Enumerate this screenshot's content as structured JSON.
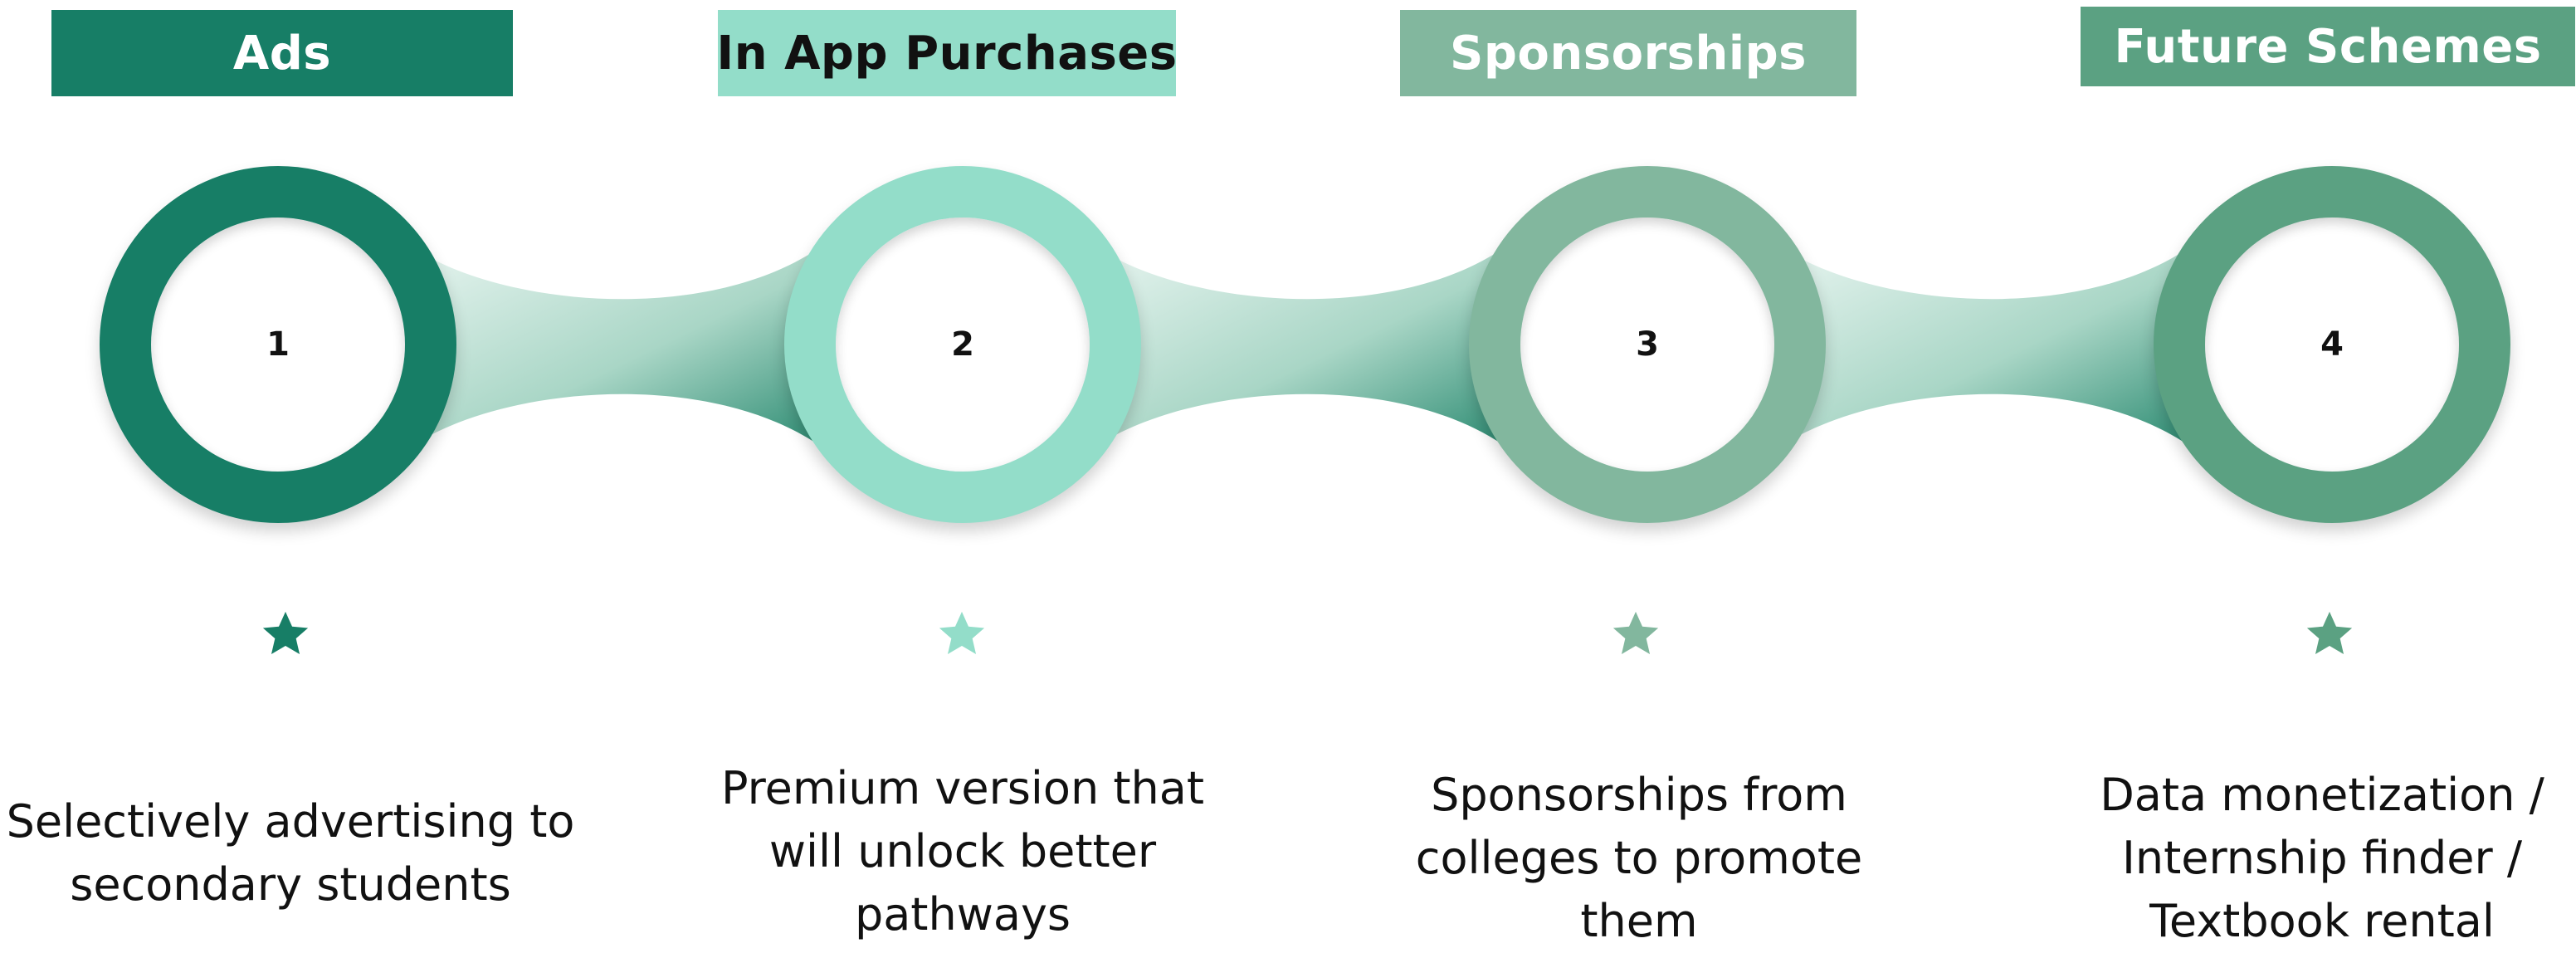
{
  "stages": [
    {
      "title": "Ads",
      "number": "1",
      "color": "#177e66",
      "title_color": "#ffffff",
      "star_icon": "star-icon",
      "description_lines": [
        "Selectively advertising to",
        "secondary students"
      ]
    },
    {
      "title": "In App Purchases",
      "number": "2",
      "color": "#93ddc9",
      "title_color": "#111111",
      "star_icon": "star-icon",
      "description_lines": [
        "Premium version that",
        "will unlock better",
        "pathways"
      ]
    },
    {
      "title": "Sponsorships",
      "number": "3",
      "color": "#82b79e",
      "title_color": "#ffffff",
      "star_icon": "star-icon",
      "description_lines": [
        "Sponsorships from",
        "colleges to promote",
        "them"
      ]
    },
    {
      "title": "Future Schemes",
      "number": "4",
      "color": "#5ba182",
      "title_color": "#ffffff",
      "star_icon": "star-icon",
      "description_lines": [
        "Data monetization /",
        "Internship finder /",
        "Textbook rental"
      ]
    }
  ]
}
